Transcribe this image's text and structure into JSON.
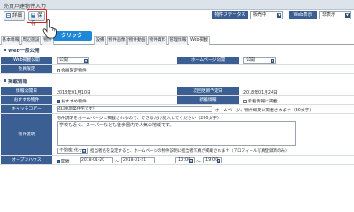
{
  "window": {
    "title": "売買戸建物件入力"
  },
  "toolbar": {
    "list_label": "詳細",
    "save_label": "保存",
    "status_label": "物件ステータス",
    "status_value": "販売中",
    "web_label": "Web表示",
    "web_value": "非表示"
  },
  "callout": "クリック",
  "tabs": [
    {
      "label": "基本情報"
    },
    {
      "label": "周辺施設"
    },
    {
      "label": "物件"
    },
    {
      "label": "設備"
    },
    {
      "label": "物件画像"
    },
    {
      "label": "物件動画"
    },
    {
      "label": "物件資料"
    },
    {
      "label": "管理情報"
    },
    {
      "label": "Web掲載"
    }
  ],
  "web_general": {
    "heading": "Web一般公開",
    "public_label": "Web掲載公開",
    "public_value": "公開",
    "homepage_label": "ホームページ公開",
    "homepage_value": "公開",
    "member_label": "会員限定",
    "member_option": "会員限定物件"
  },
  "listing": {
    "heading": "掲載情報",
    "posted_label": "情報公開日",
    "posted_value": "2018年01月10日",
    "next_update_label": "次回更新予定日",
    "next_update_value": "2018年01月24日",
    "recommend_label": "おすすめ物件",
    "recommend_option": "おすすめ物件",
    "new_label": "新着情報",
    "new_option": "新着情報に掲載",
    "catch_label": "キャッチコピー",
    "catch_value": "4LDK新築住宅です！",
    "catch_note": "ホームページ、物件概要に掲載されます（30文字）",
    "comment_label": "物件説明",
    "comment_hint": "物件説明をホームページに掲載されるので、できるだけ記入してください（200文字）",
    "comment_text": "学校も近く、スーパーなども徒歩圏内で人気の地域です。",
    "remarks_value": "不動産 花子",
    "remarks_note": "担当者名を設定すると、ホームページの物件説明に担当者写真が掲載されます（プロフィール写真登録済のみ）",
    "open_label": "オープンハウス",
    "open_option": "開催",
    "open_date_from": "2018-01-20",
    "open_range_sep": "〜",
    "open_date_to": "2018-01-21",
    "open_time_from": "10:00",
    "open_time_to": "19:00"
  }
}
